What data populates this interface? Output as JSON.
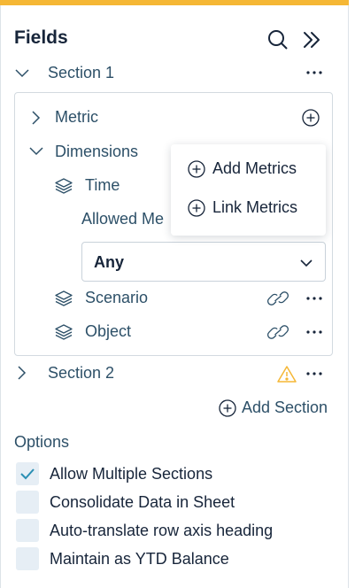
{
  "colors": {
    "accent": "#f5b735",
    "link": "#2d5068",
    "warning": "#f5b735",
    "check": "#2a8fb3"
  },
  "panel": {
    "title": "Fields",
    "search_icon": "search-icon",
    "collapse_icon": "double-chevron-right-icon"
  },
  "section1": {
    "label": "Section 1",
    "metric_label": "Metric",
    "dimensions_label": "Dimensions",
    "time_label": "Time",
    "allowed_label": "Allowed Me",
    "allowed_select_value": "Any",
    "scenario_label": "Scenario",
    "object_label": "Object"
  },
  "popover": {
    "add_metrics": "Add Metrics",
    "link_metrics": "Link Metrics"
  },
  "section2": {
    "label": "Section 2"
  },
  "add_section_label": "Add Section",
  "options": {
    "heading": "Options",
    "items": [
      {
        "label": "Allow Multiple Sections",
        "checked": true
      },
      {
        "label": "Consolidate Data in Sheet",
        "checked": false
      },
      {
        "label": "Auto-translate row axis heading",
        "checked": false
      },
      {
        "label": "Maintain as YTD Balance",
        "checked": false
      }
    ]
  }
}
